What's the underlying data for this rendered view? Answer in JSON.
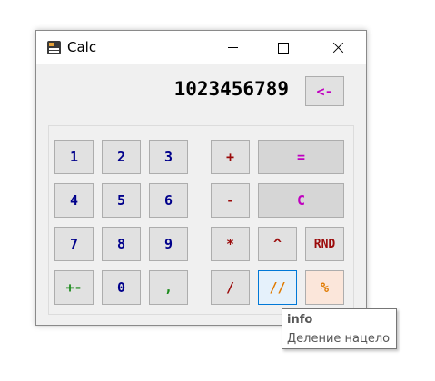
{
  "window": {
    "title": "Calc"
  },
  "display": {
    "value": "1023456789"
  },
  "buttons": {
    "backspace": "<-",
    "d1": "1",
    "d2": "2",
    "d3": "3",
    "d4": "4",
    "d5": "5",
    "d6": "6",
    "d7": "7",
    "d8": "8",
    "d9": "9",
    "negate": "+-",
    "d0": "0",
    "comma": ",",
    "plus": "+",
    "minus": "-",
    "multiply": "*",
    "divide": "/",
    "power": "^",
    "rnd": "RND",
    "int_divide": "//",
    "percent": "%",
    "equals": "=",
    "clear": "C"
  },
  "tooltip": {
    "title": "info",
    "text": "Деление нацело"
  },
  "colors": {
    "digits": "#00008b",
    "operators": "#9b0a0a",
    "special": "#c000c0",
    "negate": "#1b8a1b",
    "int_divide": "#e07a00",
    "percent": "#e07a00"
  }
}
